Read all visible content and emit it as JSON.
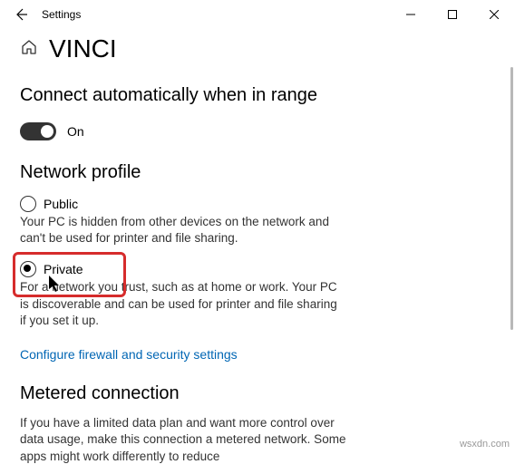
{
  "window": {
    "title": "Settings"
  },
  "page": {
    "title": "VINCI"
  },
  "auto_connect": {
    "heading": "Connect automatically when in range",
    "toggle_label": "On",
    "toggle_on": true
  },
  "profile": {
    "heading": "Network profile",
    "options": [
      {
        "label": "Public",
        "desc": "Your PC is hidden from other devices on the network and can't be used for printer and file sharing.",
        "selected": false
      },
      {
        "label": "Private",
        "desc": "For a network you trust, such as at home or work. Your PC is discoverable and can be used for printer and file sharing if you set it up.",
        "selected": true
      }
    ],
    "link": "Configure firewall and security settings"
  },
  "metered": {
    "heading": "Metered connection",
    "desc": "If you have a limited data plan and want more control over data usage, make this connection a metered network. Some apps might work differently to reduce"
  },
  "watermark": "wsxdn.com"
}
